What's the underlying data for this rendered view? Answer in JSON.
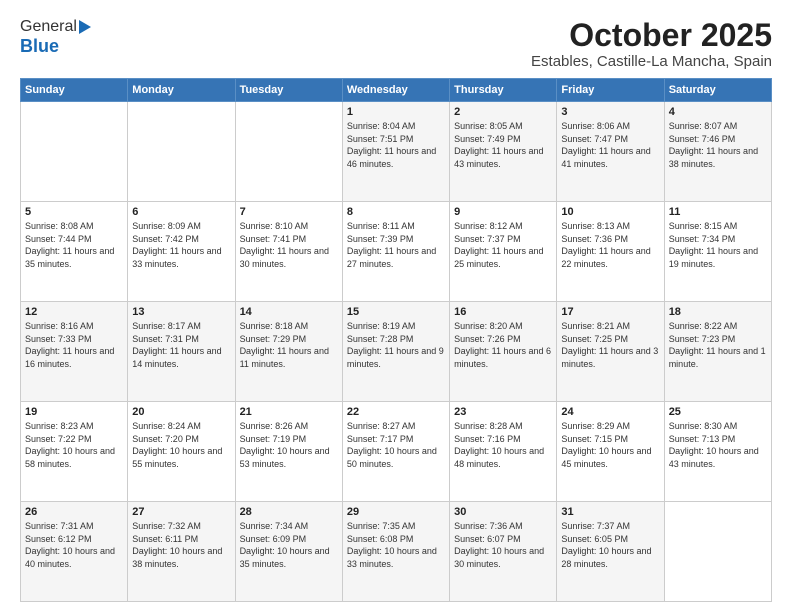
{
  "logo": {
    "general": "General",
    "blue": "Blue"
  },
  "title": "October 2025",
  "subtitle": "Estables, Castille-La Mancha, Spain",
  "days_of_week": [
    "Sunday",
    "Monday",
    "Tuesday",
    "Wednesday",
    "Thursday",
    "Friday",
    "Saturday"
  ],
  "weeks": [
    [
      {
        "day": "",
        "sunrise": "",
        "sunset": "",
        "daylight": ""
      },
      {
        "day": "",
        "sunrise": "",
        "sunset": "",
        "daylight": ""
      },
      {
        "day": "",
        "sunrise": "",
        "sunset": "",
        "daylight": ""
      },
      {
        "day": "1",
        "sunrise": "Sunrise: 8:04 AM",
        "sunset": "Sunset: 7:51 PM",
        "daylight": "Daylight: 11 hours and 46 minutes."
      },
      {
        "day": "2",
        "sunrise": "Sunrise: 8:05 AM",
        "sunset": "Sunset: 7:49 PM",
        "daylight": "Daylight: 11 hours and 43 minutes."
      },
      {
        "day": "3",
        "sunrise": "Sunrise: 8:06 AM",
        "sunset": "Sunset: 7:47 PM",
        "daylight": "Daylight: 11 hours and 41 minutes."
      },
      {
        "day": "4",
        "sunrise": "Sunrise: 8:07 AM",
        "sunset": "Sunset: 7:46 PM",
        "daylight": "Daylight: 11 hours and 38 minutes."
      }
    ],
    [
      {
        "day": "5",
        "sunrise": "Sunrise: 8:08 AM",
        "sunset": "Sunset: 7:44 PM",
        "daylight": "Daylight: 11 hours and 35 minutes."
      },
      {
        "day": "6",
        "sunrise": "Sunrise: 8:09 AM",
        "sunset": "Sunset: 7:42 PM",
        "daylight": "Daylight: 11 hours and 33 minutes."
      },
      {
        "day": "7",
        "sunrise": "Sunrise: 8:10 AM",
        "sunset": "Sunset: 7:41 PM",
        "daylight": "Daylight: 11 hours and 30 minutes."
      },
      {
        "day": "8",
        "sunrise": "Sunrise: 8:11 AM",
        "sunset": "Sunset: 7:39 PM",
        "daylight": "Daylight: 11 hours and 27 minutes."
      },
      {
        "day": "9",
        "sunrise": "Sunrise: 8:12 AM",
        "sunset": "Sunset: 7:37 PM",
        "daylight": "Daylight: 11 hours and 25 minutes."
      },
      {
        "day": "10",
        "sunrise": "Sunrise: 8:13 AM",
        "sunset": "Sunset: 7:36 PM",
        "daylight": "Daylight: 11 hours and 22 minutes."
      },
      {
        "day": "11",
        "sunrise": "Sunrise: 8:15 AM",
        "sunset": "Sunset: 7:34 PM",
        "daylight": "Daylight: 11 hours and 19 minutes."
      }
    ],
    [
      {
        "day": "12",
        "sunrise": "Sunrise: 8:16 AM",
        "sunset": "Sunset: 7:33 PM",
        "daylight": "Daylight: 11 hours and 16 minutes."
      },
      {
        "day": "13",
        "sunrise": "Sunrise: 8:17 AM",
        "sunset": "Sunset: 7:31 PM",
        "daylight": "Daylight: 11 hours and 14 minutes."
      },
      {
        "day": "14",
        "sunrise": "Sunrise: 8:18 AM",
        "sunset": "Sunset: 7:29 PM",
        "daylight": "Daylight: 11 hours and 11 minutes."
      },
      {
        "day": "15",
        "sunrise": "Sunrise: 8:19 AM",
        "sunset": "Sunset: 7:28 PM",
        "daylight": "Daylight: 11 hours and 9 minutes."
      },
      {
        "day": "16",
        "sunrise": "Sunrise: 8:20 AM",
        "sunset": "Sunset: 7:26 PM",
        "daylight": "Daylight: 11 hours and 6 minutes."
      },
      {
        "day": "17",
        "sunrise": "Sunrise: 8:21 AM",
        "sunset": "Sunset: 7:25 PM",
        "daylight": "Daylight: 11 hours and 3 minutes."
      },
      {
        "day": "18",
        "sunrise": "Sunrise: 8:22 AM",
        "sunset": "Sunset: 7:23 PM",
        "daylight": "Daylight: 11 hours and 1 minute."
      }
    ],
    [
      {
        "day": "19",
        "sunrise": "Sunrise: 8:23 AM",
        "sunset": "Sunset: 7:22 PM",
        "daylight": "Daylight: 10 hours and 58 minutes."
      },
      {
        "day": "20",
        "sunrise": "Sunrise: 8:24 AM",
        "sunset": "Sunset: 7:20 PM",
        "daylight": "Daylight: 10 hours and 55 minutes."
      },
      {
        "day": "21",
        "sunrise": "Sunrise: 8:26 AM",
        "sunset": "Sunset: 7:19 PM",
        "daylight": "Daylight: 10 hours and 53 minutes."
      },
      {
        "day": "22",
        "sunrise": "Sunrise: 8:27 AM",
        "sunset": "Sunset: 7:17 PM",
        "daylight": "Daylight: 10 hours and 50 minutes."
      },
      {
        "day": "23",
        "sunrise": "Sunrise: 8:28 AM",
        "sunset": "Sunset: 7:16 PM",
        "daylight": "Daylight: 10 hours and 48 minutes."
      },
      {
        "day": "24",
        "sunrise": "Sunrise: 8:29 AM",
        "sunset": "Sunset: 7:15 PM",
        "daylight": "Daylight: 10 hours and 45 minutes."
      },
      {
        "day": "25",
        "sunrise": "Sunrise: 8:30 AM",
        "sunset": "Sunset: 7:13 PM",
        "daylight": "Daylight: 10 hours and 43 minutes."
      }
    ],
    [
      {
        "day": "26",
        "sunrise": "Sunrise: 7:31 AM",
        "sunset": "Sunset: 6:12 PM",
        "daylight": "Daylight: 10 hours and 40 minutes."
      },
      {
        "day": "27",
        "sunrise": "Sunrise: 7:32 AM",
        "sunset": "Sunset: 6:11 PM",
        "daylight": "Daylight: 10 hours and 38 minutes."
      },
      {
        "day": "28",
        "sunrise": "Sunrise: 7:34 AM",
        "sunset": "Sunset: 6:09 PM",
        "daylight": "Daylight: 10 hours and 35 minutes."
      },
      {
        "day": "29",
        "sunrise": "Sunrise: 7:35 AM",
        "sunset": "Sunset: 6:08 PM",
        "daylight": "Daylight: 10 hours and 33 minutes."
      },
      {
        "day": "30",
        "sunrise": "Sunrise: 7:36 AM",
        "sunset": "Sunset: 6:07 PM",
        "daylight": "Daylight: 10 hours and 30 minutes."
      },
      {
        "day": "31",
        "sunrise": "Sunrise: 7:37 AM",
        "sunset": "Sunset: 6:05 PM",
        "daylight": "Daylight: 10 hours and 28 minutes."
      },
      {
        "day": "",
        "sunrise": "",
        "sunset": "",
        "daylight": ""
      }
    ]
  ]
}
